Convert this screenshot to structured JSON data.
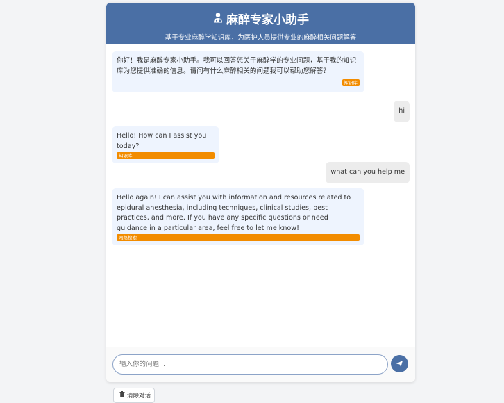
{
  "header": {
    "title": "麻醉专家小助手",
    "subtitle": "基于专业麻醉学知识库，为医护人员提供专业的麻醉相关问题解答",
    "icon": "user-doctor-icon"
  },
  "messages": [
    {
      "role": "bot",
      "text": "你好！我是麻醉专家小助手。我可以回答您关于麻醉学的专业问题，基于我的知识库为您提供准确的信息。请问有什么麻醉相关的问题我可以帮助您解答？",
      "tag": "知识库"
    },
    {
      "role": "user",
      "text": "hi"
    },
    {
      "role": "bot",
      "text": "Hello! How can I assist you today?",
      "tag": "知识库"
    },
    {
      "role": "user",
      "text": "what can you help me"
    },
    {
      "role": "bot",
      "text": "Hello again! I can assist you with information and resources related to epidural anesthesia, including techniques, clinical studies, best practices, and more. If you have any specific questions or need guidance in a particular area, feel free to let me know!",
      "tag": "网络搜索"
    }
  ],
  "input": {
    "placeholder": "输入你的问题...",
    "value": ""
  },
  "send_button": {
    "icon": "send-icon"
  },
  "clear_button": {
    "label": "清除对话",
    "icon": "trash-icon"
  },
  "colors": {
    "header_bg": "#4a6fa5",
    "bot_bubble": "#eef4fe",
    "user_bubble": "#ececec",
    "tag": "#f28c00"
  }
}
